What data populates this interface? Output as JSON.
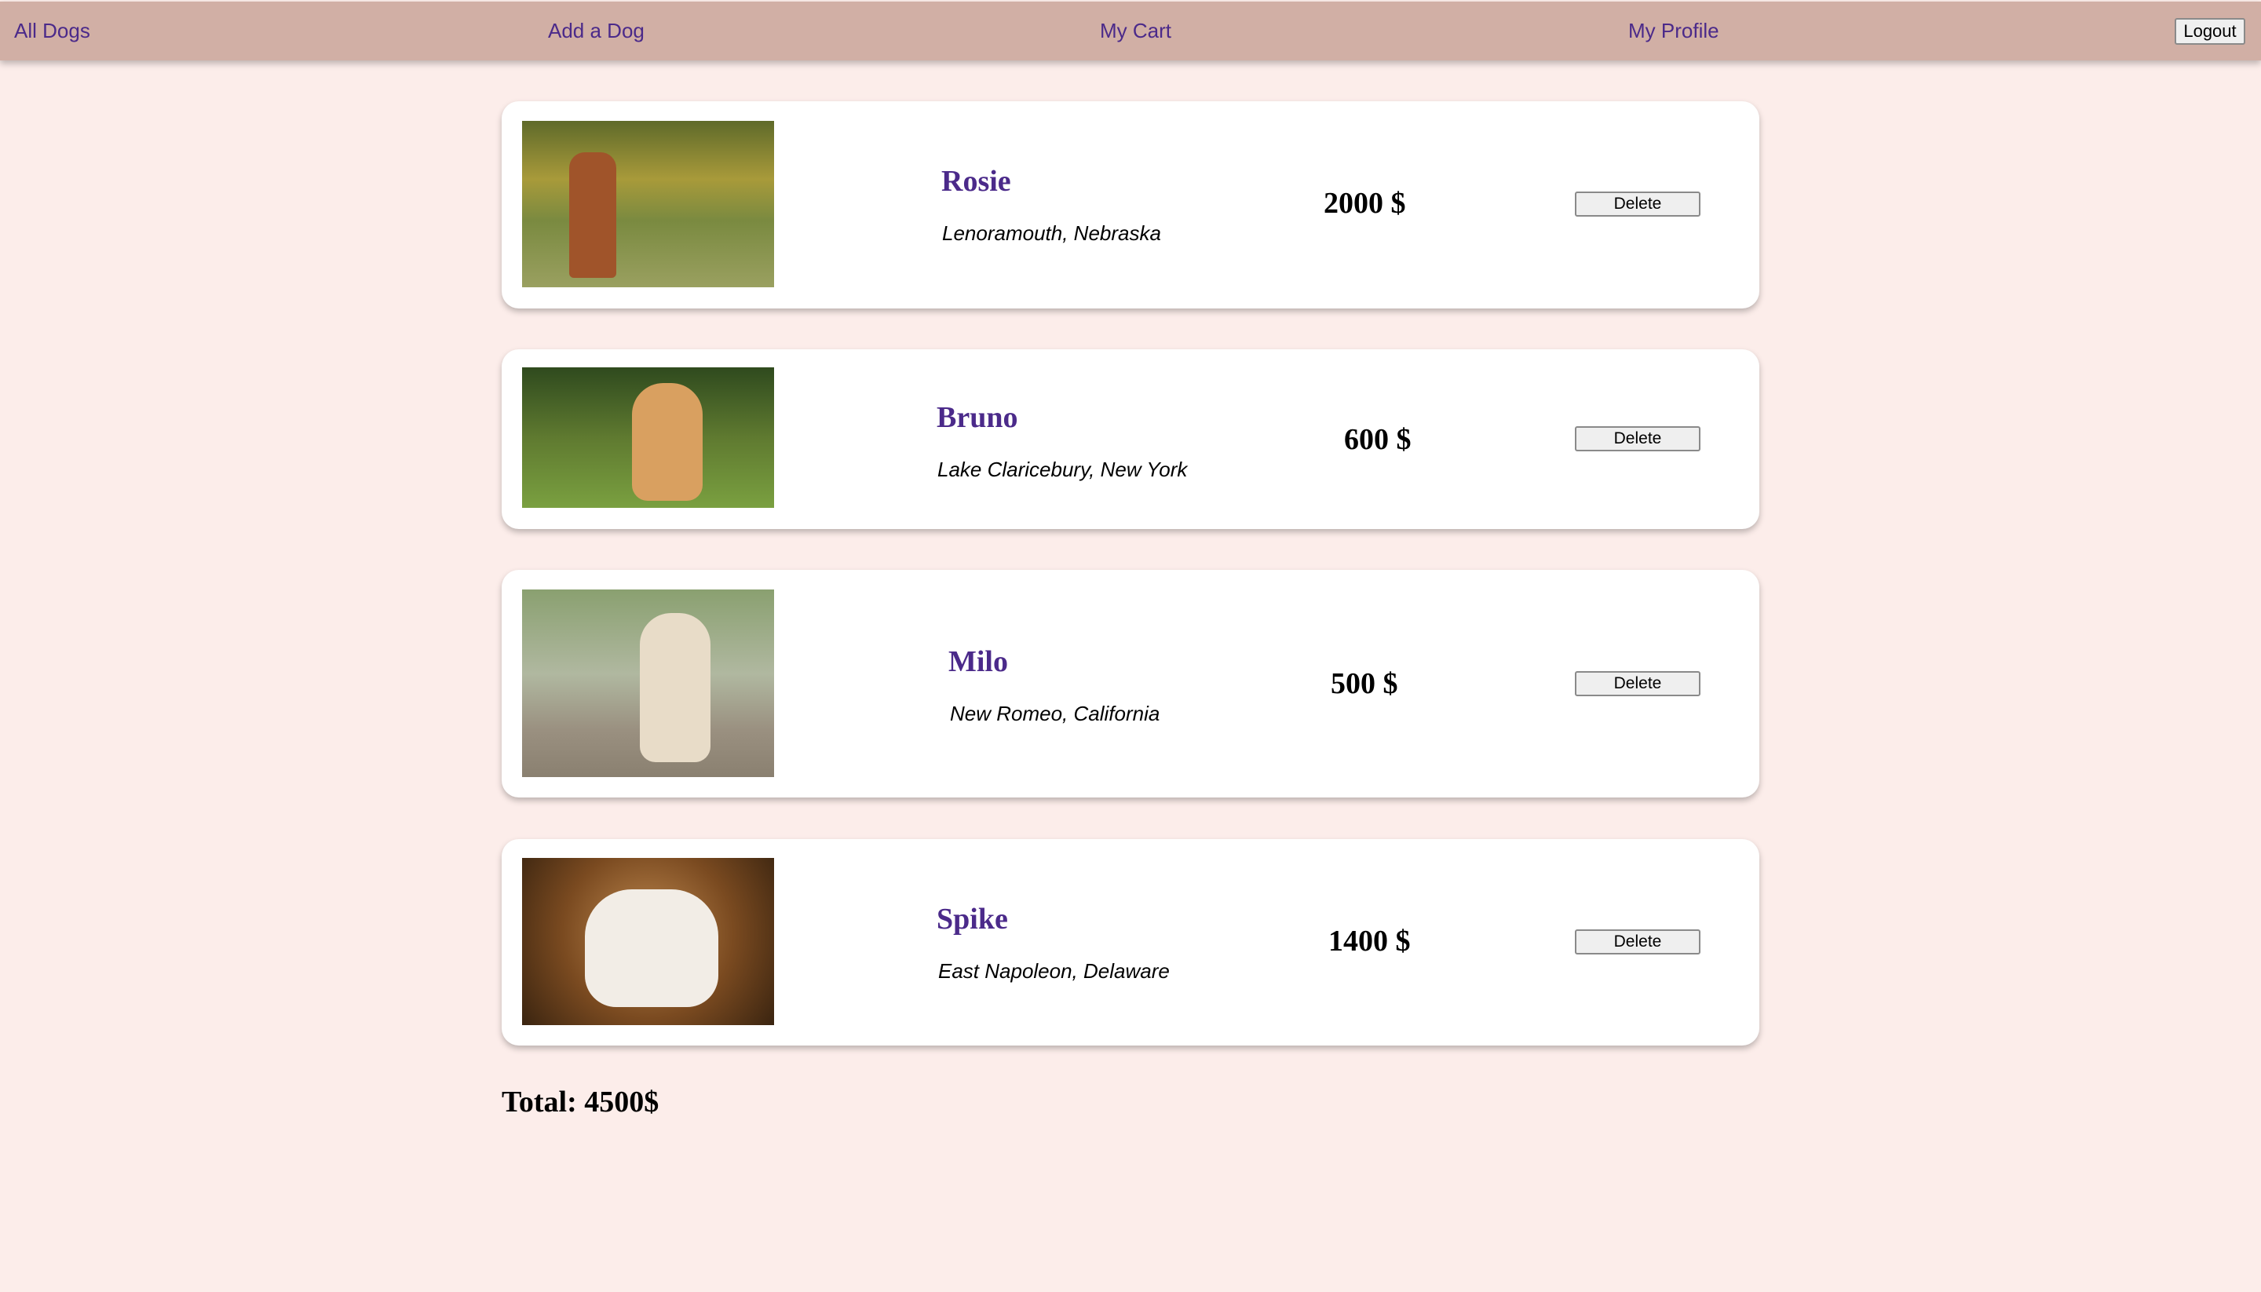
{
  "nav": {
    "all_dogs": "All Dogs",
    "add_dog": "Add a Dog",
    "my_cart": "My Cart",
    "my_profile": "My Profile",
    "logout": "Logout"
  },
  "cart": {
    "items": [
      {
        "name": "Rosie",
        "location": "Lenoramouth, Nebraska",
        "price": "2000 $",
        "delete_label": "Delete",
        "image": "vizsla-dog-photo"
      },
      {
        "name": "Bruno",
        "location": "Lake Claricebury, New York",
        "price": "600 $",
        "delete_label": "Delete",
        "image": "corgi-dog-photo"
      },
      {
        "name": "Milo",
        "location": "New Romeo, California",
        "price": "500 $",
        "delete_label": "Delete",
        "image": "pug-dog-photo"
      },
      {
        "name": "Spike",
        "location": "East Napoleon, Delaware",
        "price": "1400 $",
        "delete_label": "Delete",
        "image": "border-collie-dog-photo"
      }
    ],
    "total": "Total: 4500$"
  },
  "colors": {
    "nav_bg": "#d1afa5",
    "page_bg": "#fcedea",
    "link": "#4b2a8a"
  }
}
